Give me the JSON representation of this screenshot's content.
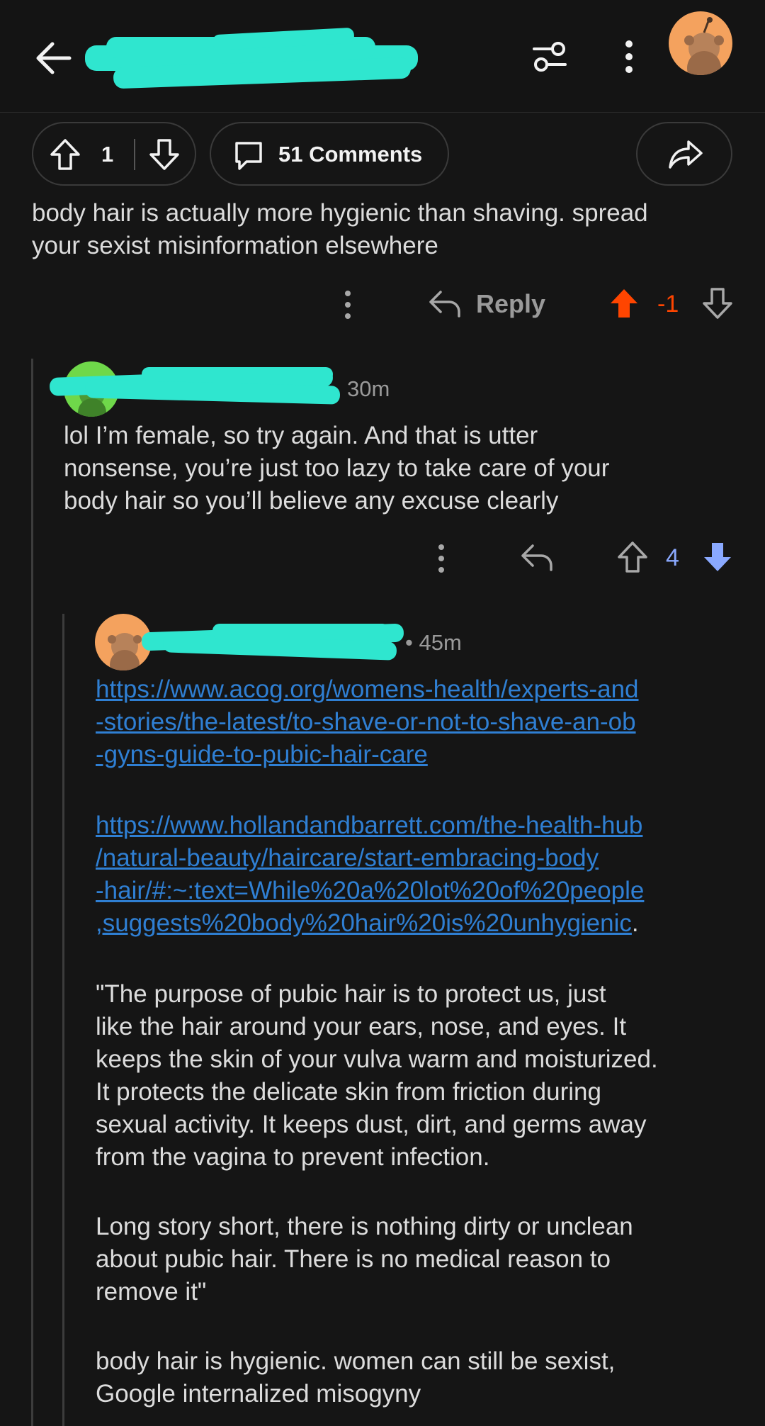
{
  "header": {
    "back_icon": "arrow-left-icon",
    "title_redacted": "",
    "filter_icon": "sliders-icon",
    "more_icon": "vertical-dots-icon",
    "avatar_color": "#f4a25e"
  },
  "post_actions": {
    "upvote_icon": "arrow-up-icon",
    "vote_count": "1",
    "downvote_icon": "arrow-down-icon",
    "comments_icon": "speech-bubble-icon",
    "comments_label": "51 Comments",
    "share_icon": "share-arrow-icon"
  },
  "comments": [
    {
      "text": "body hair is actually more hygienic than shaving. spread\nyour sexist misinformation elsewhere",
      "reply_label": "Reply",
      "score": "-1",
      "vote_state": "upvoted",
      "upvote_color": "#ff4500"
    },
    {
      "avatar_color": "#6fd84a",
      "meta_tail": "30m",
      "text": "lol I’m female, so try again.  And that is utter\nnonsense, you’re just too lazy to take care of your\nbody hair so you’ll believe any excuse clearly",
      "score": "4",
      "vote_state": "downvoted",
      "downvote_color": "#8aa9ff"
    },
    {
      "avatar_color": "#f4a25e",
      "meta_tail": "• 45m",
      "link1": "https://www.acog.org/womens-health/experts-and\n-stories/the-latest/to-shave-or-not-to-shave-an-ob\n-gyns-guide-to-pubic-hair-care",
      "link2": "https://www.hollandandbarrett.com/the-health-hub\n/natural-beauty/haircare/start-embracing-body\n-hair/#:~:text=While%20a%20lot%20of%20people\n,suggests%20body%20hair%20is%20unhygienic",
      "link2_trailing": ".",
      "quote": "\"The purpose of pubic hair is to protect us, just\nlike the hair around your ears, nose, and eyes. It\nkeeps the skin of your vulva warm and moisturized.\nIt protects the delicate skin from friction during\nsexual activity. It keeps dust, dirt, and germs away\nfrom the vagina to prevent infection.",
      "quote2": "Long story short, there is nothing dirty or unclean\nabout pubic hair. There is no medical reason to\nremove it\"",
      "closing": "body hair is hygienic. women can still be sexist,\nGoogle internalized misogyny"
    }
  ]
}
